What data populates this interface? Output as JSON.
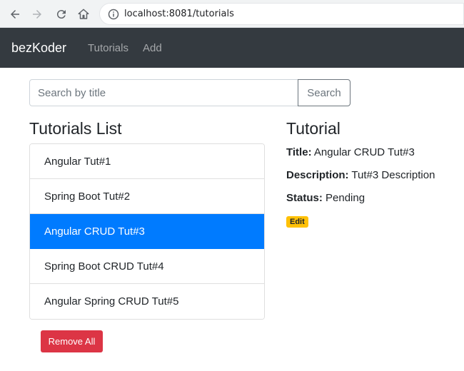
{
  "browser": {
    "url": "localhost:8081/tutorials"
  },
  "navbar": {
    "brand": "bezKoder",
    "links": [
      "Tutorials",
      "Add"
    ]
  },
  "search": {
    "placeholder": "Search by title",
    "value": "",
    "button_label": "Search"
  },
  "list": {
    "title": "Tutorials List",
    "items": [
      "Angular Tut#1",
      "Spring Boot Tut#2",
      "Angular CRUD Tut#3",
      "Spring Boot CRUD Tut#4",
      "Angular Spring CRUD Tut#5"
    ],
    "active_index": 2,
    "remove_all_label": "Remove All"
  },
  "detail": {
    "heading": "Tutorial",
    "title_label": "Title:",
    "title_value": "Angular CRUD Tut#3",
    "description_label": "Description:",
    "description_value": "Tut#3 Description",
    "status_label": "Status:",
    "status_value": "Pending",
    "edit_label": "Edit"
  },
  "colors": {
    "navbar_bg": "#343a40",
    "active_item": "#007bff",
    "danger": "#dc3545",
    "warning": "#ffc107"
  },
  "icons": [
    "back-arrow-icon",
    "forward-arrow-icon",
    "reload-icon",
    "home-icon",
    "info-icon"
  ]
}
